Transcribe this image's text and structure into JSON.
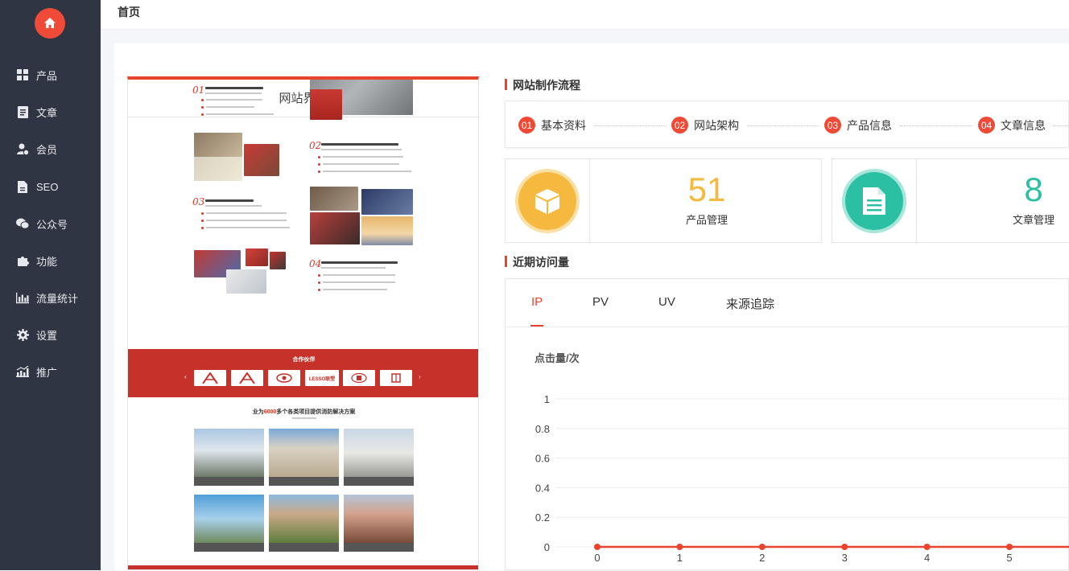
{
  "topbar": {
    "title": "首页"
  },
  "sidebar": {
    "items": [
      {
        "label": "产品",
        "icon": "grid-icon"
      },
      {
        "label": "文章",
        "icon": "document-icon"
      },
      {
        "label": "会员",
        "icon": "user-check-icon"
      },
      {
        "label": "SEO",
        "icon": "file-icon"
      },
      {
        "label": "公众号",
        "icon": "wechat-icon"
      },
      {
        "label": "功能",
        "icon": "puzzle-icon"
      },
      {
        "label": "流量统计",
        "icon": "bar-chart-icon"
      },
      {
        "label": "设置",
        "icon": "gear-icon"
      },
      {
        "label": "推广",
        "icon": "growth-chart-icon"
      }
    ]
  },
  "preview": {
    "title": "网站界面",
    "partners_label": "合作伙伴",
    "partner_logos": [
      "LESSO联塑"
    ],
    "solutions_title_prefix": "业为",
    "solutions_title_highlight": "6000",
    "solutions_title_suffix": "多个各类项目提供消防解决方案"
  },
  "flow": {
    "title": "网站制作流程",
    "steps": [
      {
        "num": "01",
        "label": "基本资料"
      },
      {
        "num": "02",
        "label": "网站架构"
      },
      {
        "num": "03",
        "label": "产品信息"
      },
      {
        "num": "04",
        "label": "文章信息"
      }
    ]
  },
  "stats": [
    {
      "value": "51",
      "label": "产品管理",
      "color": "#f5b93f",
      "icon": "box-icon"
    },
    {
      "value": "8",
      "label": "文章管理",
      "color": "#2bbfa4",
      "icon": "document-icon"
    }
  ],
  "visits": {
    "title": "近期访问量",
    "tabs": [
      "IP",
      "PV",
      "UV",
      "来源追踪"
    ],
    "active_tab": "IP",
    "ylabel": "点击量/次"
  },
  "chart_data": {
    "type": "line",
    "x": [
      0,
      1,
      2,
      3,
      4,
      5
    ],
    "series": [
      {
        "values": [
          0,
          0,
          0,
          0,
          0,
          0
        ]
      }
    ],
    "ylim": [
      0,
      1
    ],
    "yticks": [
      "0",
      "0.2",
      "0.4",
      "0.6",
      "0.8",
      "1"
    ],
    "xticks": [
      "0",
      "1",
      "2",
      "3",
      "4",
      "5"
    ],
    "ylabel": "点击量/次",
    "grid": true,
    "color": "#e8432e"
  }
}
